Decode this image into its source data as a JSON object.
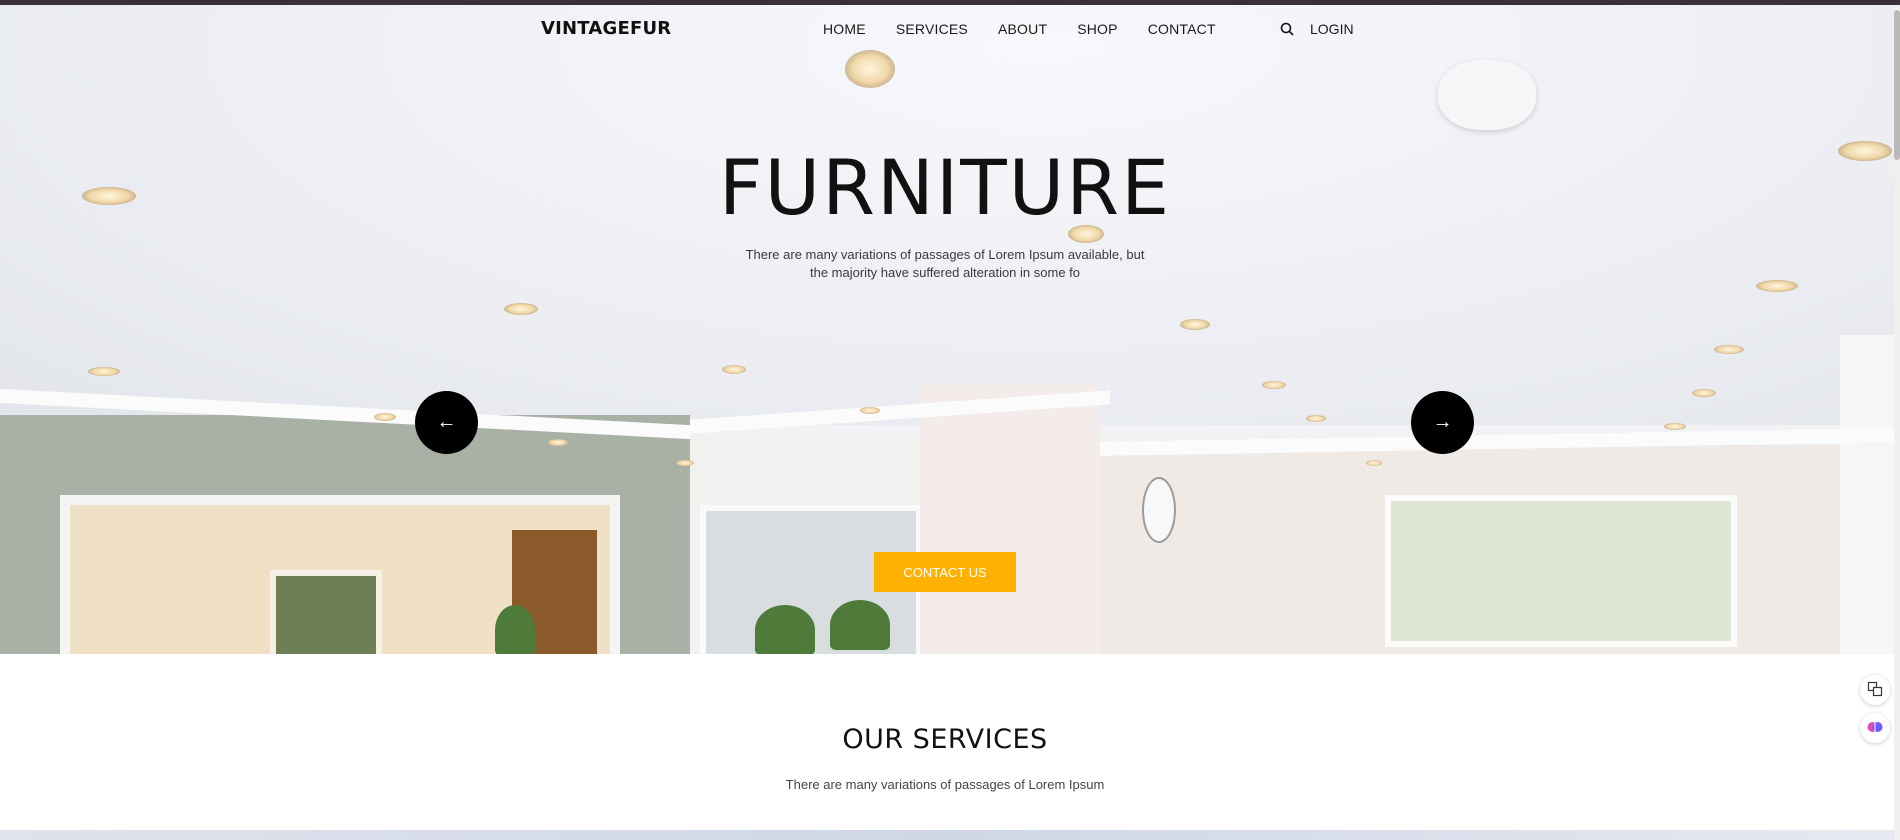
{
  "nav": {
    "brand": "VINTAGEFUR",
    "links": [
      "HOME",
      "SERVICES",
      "ABOUT",
      "SHOP",
      "CONTACT"
    ],
    "search_icon": "search-icon",
    "login": "LOGIN"
  },
  "hero": {
    "title": "FURNITURE",
    "subtitle": "There are many variations of passages of Lorem Ipsum available, but the majority have suffered alteration in some fo",
    "prev_arrow": "←",
    "next_arrow": "→",
    "cta": "CONTACT US"
  },
  "services": {
    "title": "OUR SERVICES",
    "subtitle": "There are many variations of passages of Lorem Ipsum"
  },
  "side_widgets": [
    "translate-icon",
    "brain-icon"
  ],
  "colors": {
    "accent": "#ffb100",
    "arrow_bg": "#000000",
    "text": "#111111"
  }
}
